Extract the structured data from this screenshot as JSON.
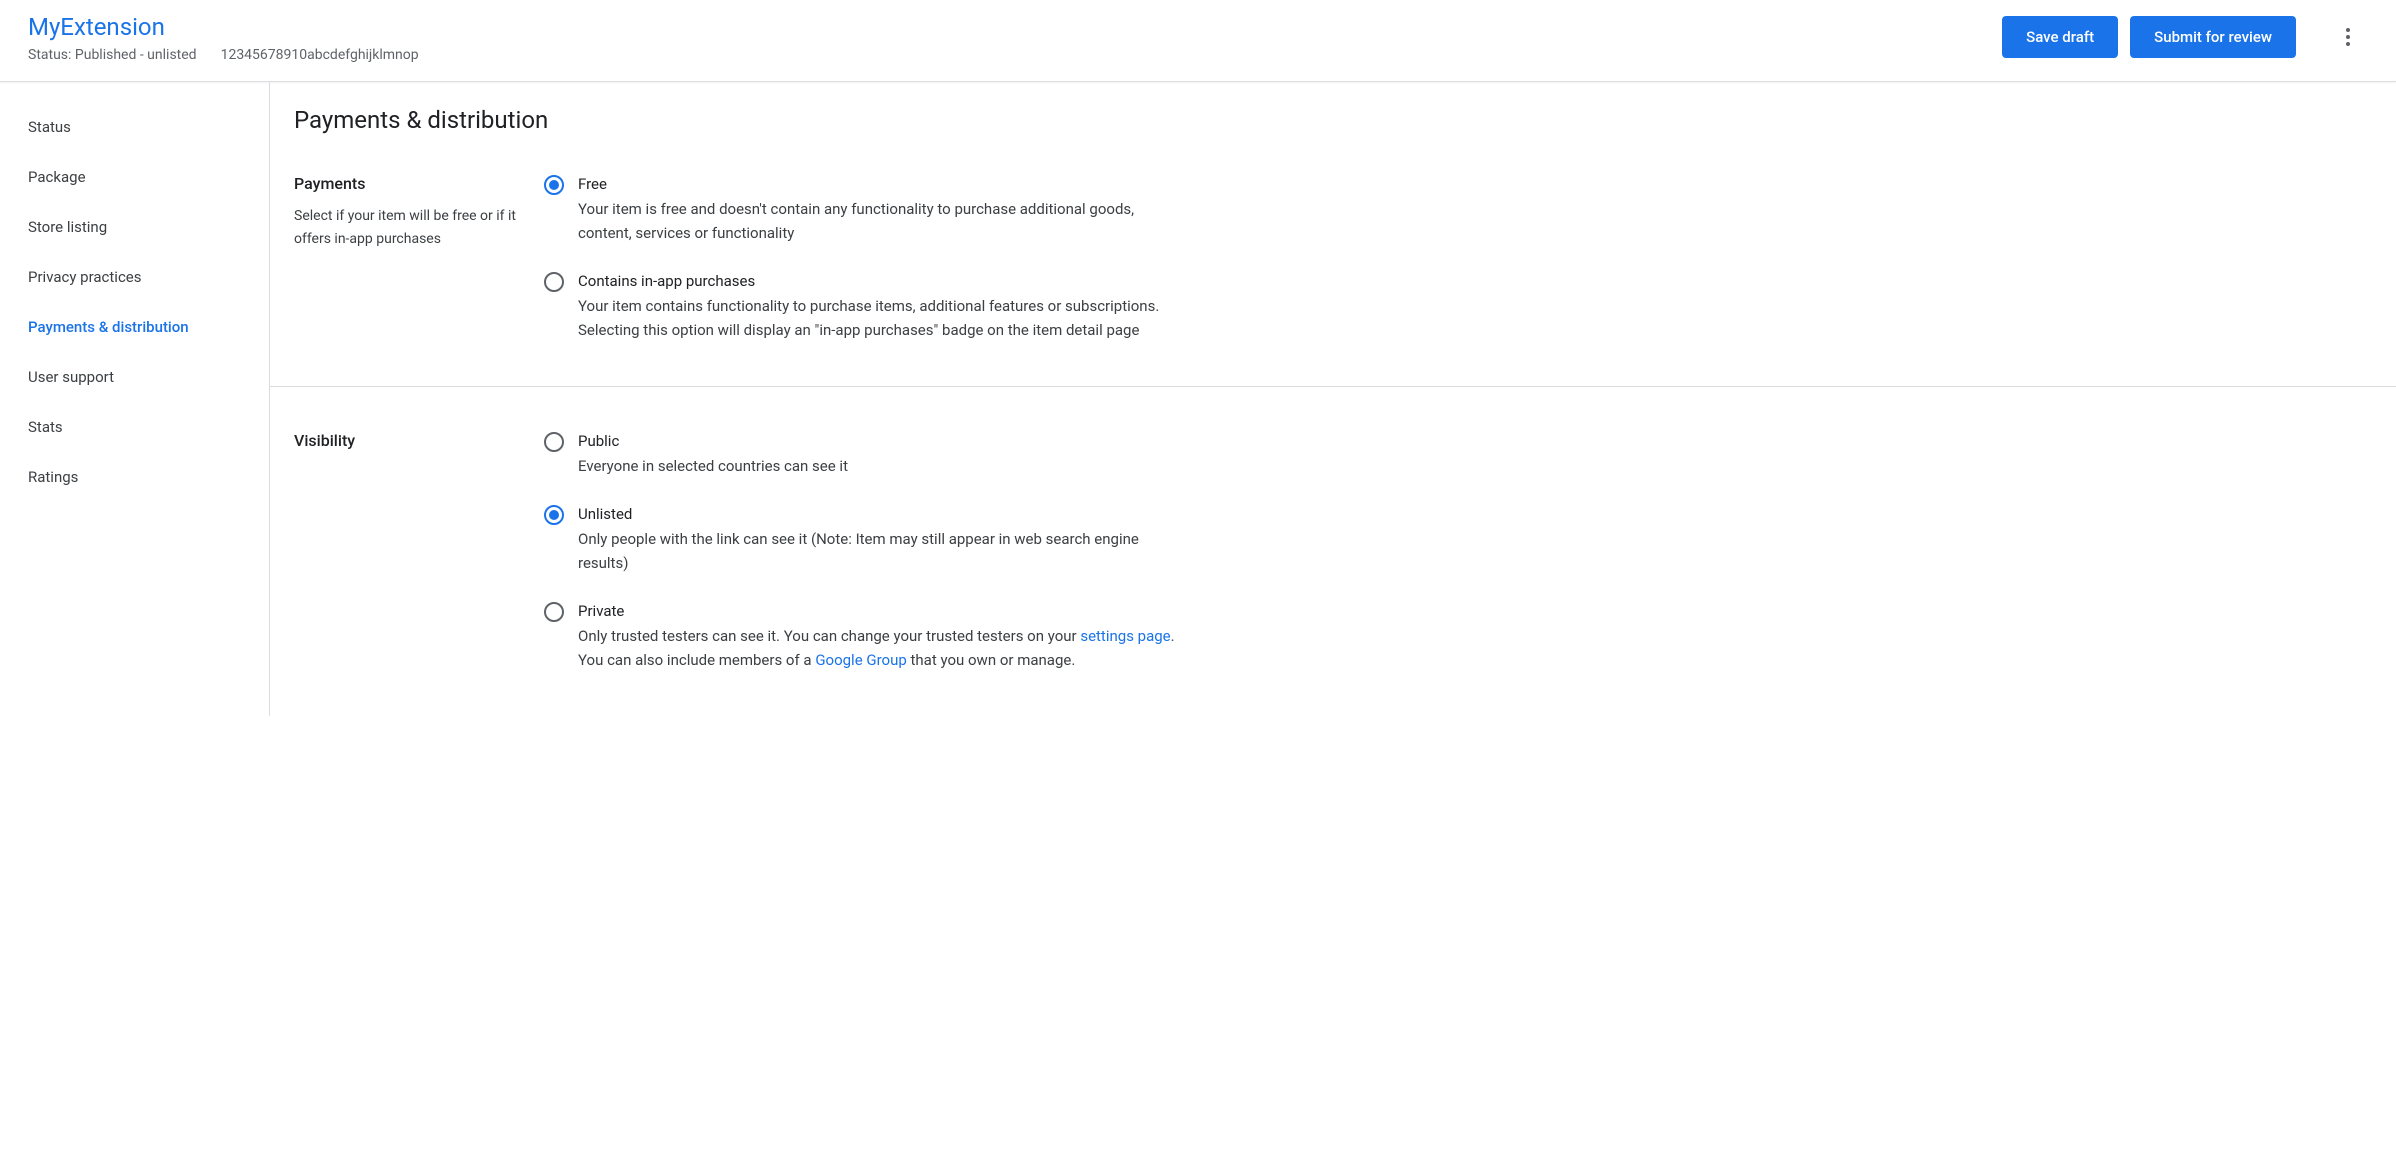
{
  "header": {
    "title": "MyExtension",
    "status": "Status: Published - unlisted",
    "id": "12345678910abcdefghijklmnop",
    "save_draft": "Save draft",
    "submit_review": "Submit for review"
  },
  "sidebar": {
    "items": [
      {
        "label": "Status",
        "active": false
      },
      {
        "label": "Package",
        "active": false
      },
      {
        "label": "Store listing",
        "active": false
      },
      {
        "label": "Privacy practices",
        "active": false
      },
      {
        "label": "Payments & distribution",
        "active": true
      },
      {
        "label": "User support",
        "active": false
      },
      {
        "label": "Stats",
        "active": false
      },
      {
        "label": "Ratings",
        "active": false
      }
    ]
  },
  "main": {
    "title": "Payments & distribution",
    "payments": {
      "heading": "Payments",
      "description": "Select if your item will be free or if it offers in-app purchases",
      "options": [
        {
          "label": "Free",
          "desc": "Your item is free and doesn't contain any functionality to purchase additional goods, content, services or functionality",
          "checked": true
        },
        {
          "label": "Contains in-app purchases",
          "desc": "Your item contains functionality to purchase items, additional features or subscriptions. Selecting this option will display an \"in-app purchases\" badge on the item detail page",
          "checked": false
        }
      ]
    },
    "visibility": {
      "heading": "Visibility",
      "options": [
        {
          "label": "Public",
          "desc": "Everyone in selected countries can see it",
          "checked": false
        },
        {
          "label": "Unlisted",
          "desc": "Only people with the link can see it (Note: Item may still appear in web search engine results)",
          "checked": true
        },
        {
          "label": "Private",
          "desc_pre": "Only trusted testers can see it. You can change your trusted testers on your ",
          "link1": "settings page",
          "desc_mid": ".",
          "desc_line2_pre": "You can also include members of a ",
          "link2": "Google Group",
          "desc_line2_post": " that you own or manage.",
          "checked": false
        }
      ]
    }
  }
}
